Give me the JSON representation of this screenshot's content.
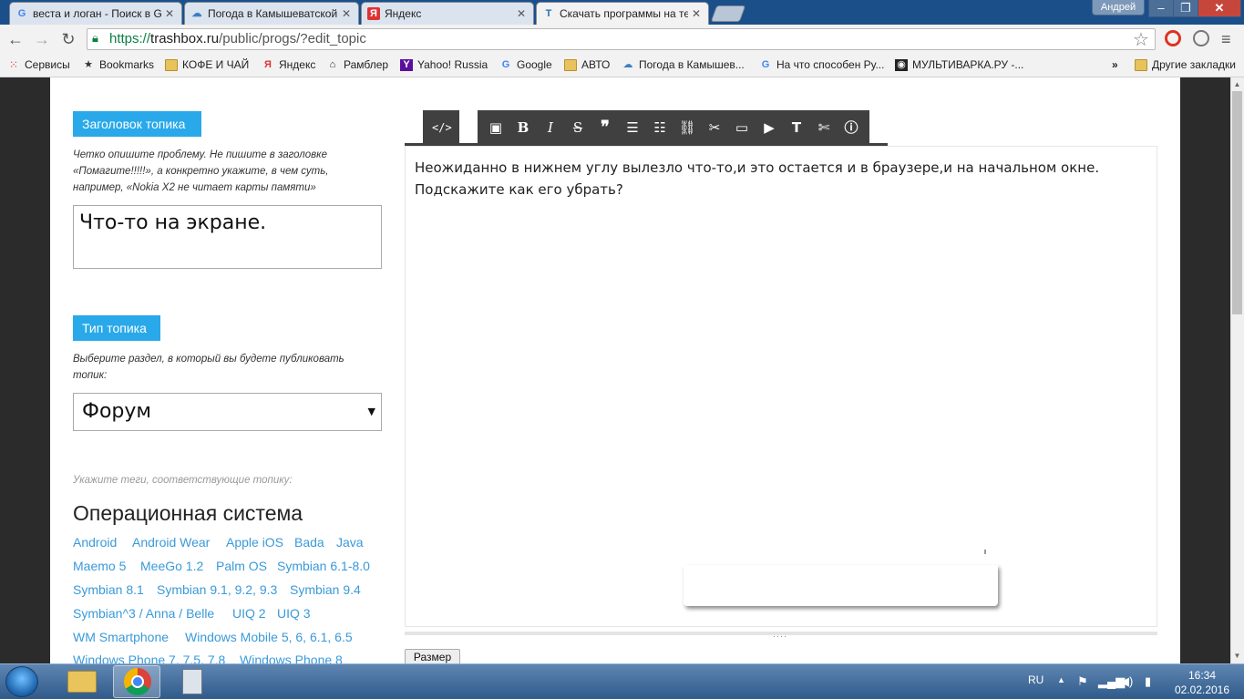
{
  "browser": {
    "tabs": [
      {
        "favicon": "G",
        "title": "веста и логан - Поиск в G",
        "active": false
      },
      {
        "favicon": "☁",
        "title": "Погода в Камышеватской",
        "active": false
      },
      {
        "favicon": "Я",
        "title": "Яндекс",
        "active": false
      },
      {
        "favicon": "T",
        "title": "Скачать программы на те",
        "active": true
      }
    ],
    "user_name": "Андрей",
    "url": {
      "scheme": "https://",
      "domain": "trashbox.ru",
      "path": "/public/progs/?edit_topic"
    },
    "bookmarks": [
      {
        "label": "Сервисы",
        "icon": "apps-icon"
      },
      {
        "label": "Bookmarks",
        "icon": "star-icon"
      },
      {
        "label": "КОФЕ И ЧАЙ",
        "icon": "folder-icon"
      },
      {
        "label": "Яндекс",
        "icon": "yandex-icon"
      },
      {
        "label": "Рамблер",
        "icon": "home-icon"
      },
      {
        "label": "Yahoo! Russia",
        "icon": "yahoo-icon"
      },
      {
        "label": "Google",
        "icon": "google-icon"
      },
      {
        "label": "АВТО",
        "icon": "folder-icon"
      },
      {
        "label": "Погода в Камышев...",
        "icon": "weather-icon"
      },
      {
        "label": "На что способен Ру...",
        "icon": "google-icon"
      },
      {
        "label": "МУЛЬТИВАРКА.РУ -...",
        "icon": "multivarka-icon"
      }
    ],
    "bookmarks_overflow": "»",
    "other_bookmarks": "Другие закладки"
  },
  "form": {
    "title_section": {
      "label": "Заголовок топика",
      "hint": "Четко опишите проблему. Не пишите в заголовке «Помагите!!!!!», а конкретно укажите, в чем суть, например, «Nokia X2 не читает карты памяти»",
      "value": "Что-то на экране."
    },
    "type_section": {
      "label": "Тип топика",
      "hint": "Выберите раздел, в который вы будете публиковать топик:",
      "selected": "Форум"
    },
    "tags_hint": "Укажите теги, соответствующие топику:",
    "os_heading": "Операционная система",
    "os_tags": [
      [
        "Android",
        "Android Wear",
        "Apple iOS",
        "Bada",
        "Java"
      ],
      [
        "Maemo 5",
        "MeeGo 1.2",
        "Palm OS",
        "Symbian 6.1-8.0"
      ],
      [
        "Symbian 8.1",
        "Symbian 9.1, 9.2, 9.3",
        "Symbian 9.4"
      ],
      [
        "Symbian^3 / Anna / Belle",
        "UIQ 2",
        "UIQ 3"
      ],
      [
        "WM Smartphone",
        "Windows Mobile 5, 6, 6.1, 6.5"
      ],
      [
        "Windows Phone 7, 7.5, 7.8",
        "Windows Phone 8"
      ]
    ]
  },
  "editor": {
    "toolbar_buttons": [
      "code-icon",
      "header-icon",
      "bold-icon",
      "italic-icon",
      "strikethrough-icon",
      "quote-icon",
      "ordered-list-icon",
      "unordered-list-icon",
      "link-icon",
      "unlink-icon",
      "image-icon",
      "video-icon",
      "text-icon",
      "cut-icon",
      "info-icon"
    ],
    "text_line1": "Неожиданно в нижнем углу вылезло что-то,и это остается и в браузере,и на начальном окне.",
    "text_line2": "Подскажите как его убрать?",
    "resize_handle": "····",
    "size_button": "Размер"
  },
  "taskbar": {
    "apps": [
      "explorer",
      "chrome",
      "calculator"
    ],
    "language": "RU",
    "time": "16:34",
    "date": "02.02.2016"
  }
}
